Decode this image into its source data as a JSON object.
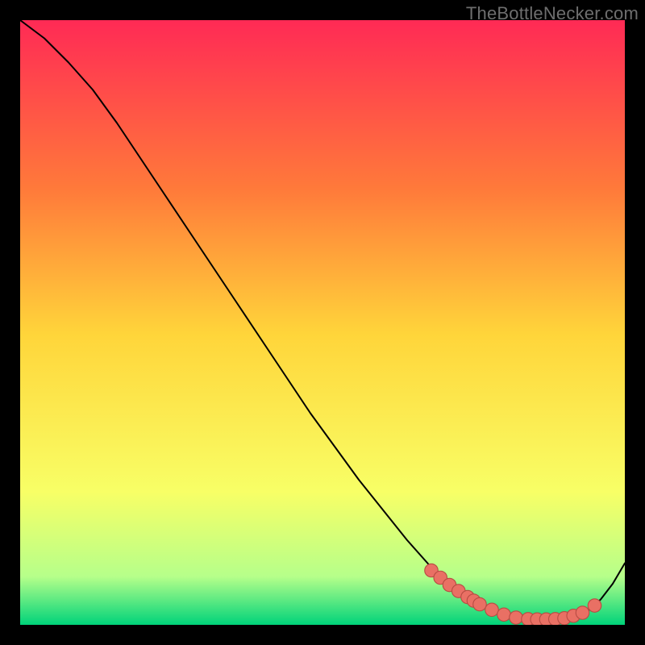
{
  "watermark": "TheBottleNecker.com",
  "colors": {
    "background": "#000000",
    "watermark": "#6e6e6e",
    "curve": "#000000",
    "marker_fill": "#e97064",
    "marker_stroke": "#b84c43",
    "grad_top": "#ff2a55",
    "grad_mid1": "#ff7a3a",
    "grad_mid2": "#ffd53a",
    "grad_mid3": "#f8ff66",
    "grad_bot1": "#b6ff8a",
    "grad_bot2": "#00d37a"
  },
  "chart_data": {
    "type": "line",
    "title": "",
    "xlabel": "",
    "ylabel": "",
    "xlim": [
      0,
      100
    ],
    "ylim": [
      0,
      100
    ],
    "x": [
      0,
      4,
      8,
      12,
      16,
      20,
      24,
      28,
      32,
      36,
      40,
      44,
      48,
      52,
      56,
      60,
      64,
      68,
      72,
      76,
      80,
      83,
      86,
      89,
      92,
      94,
      96,
      98,
      100
    ],
    "values": [
      100,
      97,
      93,
      88.5,
      83,
      77,
      71,
      65,
      59,
      53,
      47,
      41,
      35,
      29.5,
      24,
      19,
      14,
      9.5,
      6,
      3.2,
      1.6,
      1.0,
      0.9,
      1.0,
      1.4,
      2.4,
      4.2,
      6.8,
      10.2
    ],
    "markers_x": [
      68,
      69.5,
      71,
      72.5,
      74,
      75,
      76,
      78,
      80,
      82,
      84,
      85.5,
      87,
      88.5,
      90,
      91.5,
      93,
      95
    ],
    "markers_y": [
      9.0,
      7.8,
      6.6,
      5.6,
      4.6,
      4.0,
      3.4,
      2.5,
      1.7,
      1.2,
      0.95,
      0.9,
      0.9,
      0.95,
      1.1,
      1.5,
      2.0,
      3.2
    ],
    "gradient_stops": [
      {
        "offset": 0.0,
        "key": "grad_top"
      },
      {
        "offset": 0.28,
        "key": "grad_mid1"
      },
      {
        "offset": 0.52,
        "key": "grad_mid2"
      },
      {
        "offset": 0.78,
        "key": "grad_mid3"
      },
      {
        "offset": 0.92,
        "key": "grad_bot1"
      },
      {
        "offset": 1.0,
        "key": "grad_bot2"
      }
    ]
  }
}
